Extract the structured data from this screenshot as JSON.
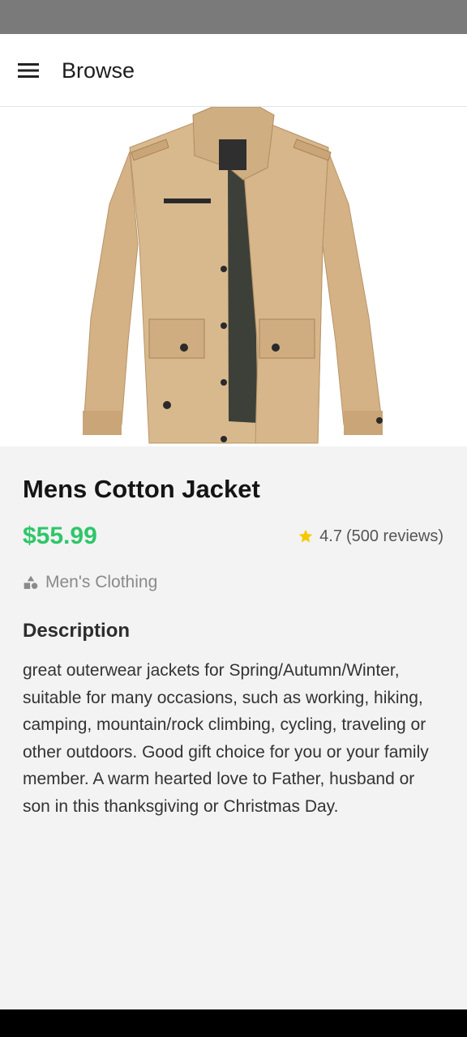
{
  "app_bar": {
    "title": "Browse",
    "menu_icon": "hamburger-menu-icon"
  },
  "product": {
    "image_alt": "jacket-image",
    "title": "Mens Cotton Jacket",
    "price": "$55.99",
    "rating": {
      "value": "4.7",
      "count_text": "(500 reviews)",
      "icon": "star-icon"
    },
    "category": {
      "label": "Men's Clothing",
      "icon": "category-shapes-icon"
    },
    "description_heading": "Description",
    "description": "great outerwear jackets for Spring/Autumn/Winter, suitable for many occasions, such as working, hiking, camping, mountain/rock climbing, cycling, traveling or other outdoors. Good gift choice for you or your family member. A warm hearted love to Father, husband or son in this thanksgiving or Christmas Day."
  },
  "colors": {
    "price": "#2ec66a",
    "star": "#f7c800",
    "jacket": "#d8b98e",
    "status_bar": "#7a7a7a",
    "nav_bar": "#000000"
  }
}
